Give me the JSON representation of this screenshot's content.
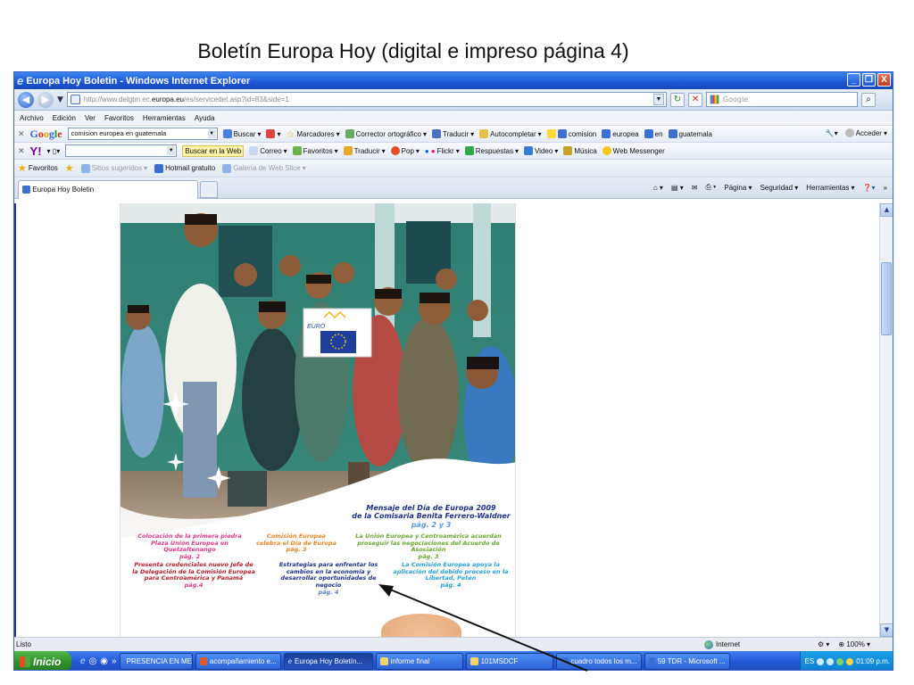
{
  "slide": {
    "title": "Boletín Europa Hoy (digital e impreso página 4)"
  },
  "window": {
    "title": "Europa Hoy Boletin - Windows Internet Explorer",
    "controls": {
      "minimize": "_",
      "maximize": "❐",
      "close": "X"
    }
  },
  "address": {
    "url_prefix": "http://www.delgtm.ec.",
    "url_domain": "europa.eu",
    "url_suffix": "/es/servicedet.asp?id=83&side=1",
    "search_placeholder": "Google"
  },
  "menu": [
    "Archivo",
    "Edición",
    "Ver",
    "Favoritos",
    "Herramientas",
    "Ayuda"
  ],
  "google_toolbar": {
    "logo": "Google",
    "query": "comision europea en guatemala",
    "items": [
      "Buscar",
      "Marcadores",
      "Corrector ortográfico",
      "Traducir",
      "Autocompletar",
      "comision",
      "europea",
      "en",
      "guatemala"
    ],
    "right": [
      "Acceder"
    ]
  },
  "yahoo_toolbar": {
    "logo": "Y!",
    "search_button": "Buscar en la Web",
    "items": [
      "Correo",
      "Favoritos",
      "Traducir",
      "Pop",
      "Flickr",
      "Respuestas",
      "Video",
      "Música",
      "Web Messenger"
    ]
  },
  "favorites_bar": {
    "favorites": "Favoritos",
    "items": [
      "Sitios sugeridos",
      "Hotmail gratuito",
      "Galería de Web Slice"
    ]
  },
  "tabs": {
    "active_tab": "Europa Hoy Boletin",
    "commands": [
      "Página",
      "Seguridad",
      "Herramientas"
    ]
  },
  "newsletter": {
    "badge": "EURO",
    "headline": {
      "line1": "Mensaje del Día de Europa 2009",
      "line2": "de la Comisaria Benita Ferrero-Waldner",
      "page": "pág. 2 y 3"
    },
    "articles": [
      {
        "text": "Colocación de la primera piedra Plaza Unión Europea en Quetzaltenango",
        "page": "pág. 2"
      },
      {
        "text": "Comisión Europea celebra el Día de Europa",
        "page": "pág. 3"
      },
      {
        "text": "La Unión Europea y Centroamérica acuerdan proseguir las negociaciones del Acuerdo de Asociación",
        "page": "pág. 3"
      },
      {
        "text": "Presenta credenciales nuevo Jefe de la Delegación de la Comisión Europea para Centroamérica y Panamá",
        "page": "pág.4"
      },
      {
        "text": "Estrategias para enfrentar los cambios en la economía y desarrollar oportunidades de negocio",
        "page": "pág. 4"
      },
      {
        "text": "La Comisión Europea apoya la aplicación del debido proceso en la Libertad, Petén",
        "page": "pág. 4"
      }
    ],
    "colors": {
      "navy": "#1d2f86",
      "pink": "#d93a8a",
      "orange": "#e5862a",
      "green": "#6aa52f",
      "red": "#b01f2a",
      "cyan": "#2a9fd6"
    }
  },
  "status": {
    "left": "Listo",
    "zone": "Internet",
    "zoom": "100%"
  },
  "taskbar": {
    "start": "Inicio",
    "tasks": [
      "PRESENCIA EN ME...",
      "acompañamiento e...",
      "Europa Hoy Boletín...",
      "informe final",
      "101MSDCF",
      "cuadro todos los m...",
      "59 TDR - Microsoft ...",
      "ES"
    ],
    "clock": "01:09 p.m."
  }
}
